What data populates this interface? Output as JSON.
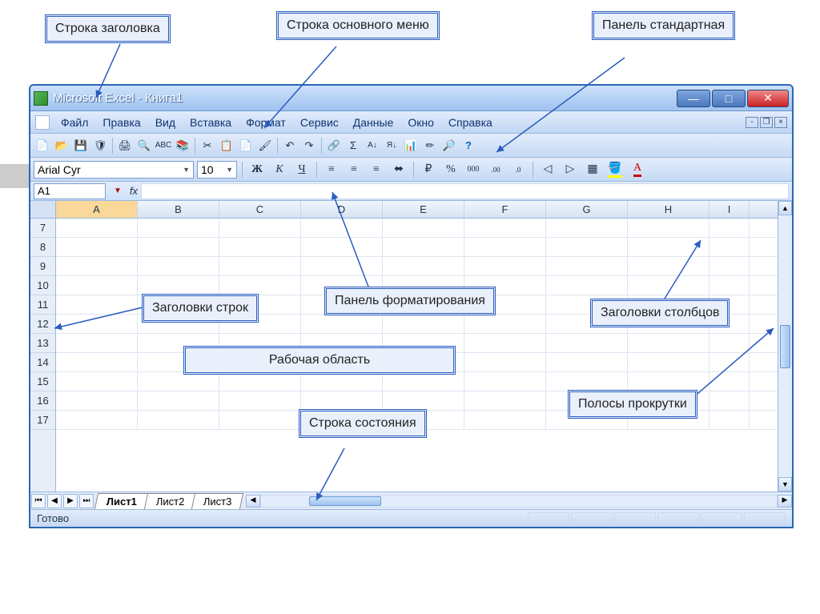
{
  "callouts": {
    "title_bar": "Строка заголовка",
    "main_menu": "Строка основного меню",
    "std_toolbar": "Панель стандартная",
    "row_headers": "Заголовки строк",
    "format_toolbar": "Панель форматирования",
    "col_headers": "Заголовки столбцов",
    "workspace": "Рабочая область",
    "status_bar": "Строка состояния",
    "scrollbars": "Полосы прокрутки"
  },
  "window": {
    "title": "Microsoft Excel - Книга1"
  },
  "menu": {
    "items": [
      "Файл",
      "Правка",
      "Вид",
      "Вставка",
      "Формат",
      "Сервис",
      "Данные",
      "Окно",
      "Справка"
    ]
  },
  "standard_toolbar": {
    "icons": [
      "new",
      "open",
      "save",
      "permission",
      "print",
      "preview",
      "spelling",
      "research",
      "cut",
      "copy",
      "paste",
      "format-painter",
      "undo",
      "redo",
      "hyperlink",
      "autosum",
      "sort-asc",
      "sort-desc",
      "chart",
      "drawing",
      "zoom",
      "help"
    ]
  },
  "format_toolbar": {
    "font": "Arial Cyr",
    "size": "10",
    "bold": "Ж",
    "italic": "К",
    "underline": "Ч",
    "buttons": [
      "align-left",
      "align-center",
      "align-right",
      "merge",
      "currency",
      "percent",
      "comma",
      "inc-dec",
      "dec-dec",
      "indent-dec",
      "indent-inc",
      "borders",
      "fill",
      "font-color"
    ]
  },
  "formula_bar": {
    "name_box": "A1",
    "fx": "fx"
  },
  "grid": {
    "columns": [
      "A",
      "B",
      "C",
      "D",
      "E",
      "F",
      "G",
      "H",
      "I"
    ],
    "rows": [
      "7",
      "8",
      "9",
      "10",
      "11",
      "12",
      "13",
      "14",
      "15",
      "16",
      "17"
    ],
    "selected_col": "A"
  },
  "sheets": {
    "tabs": [
      "Лист1",
      "Лист2",
      "Лист3"
    ],
    "active": 0
  },
  "status": {
    "ready": "Готово"
  }
}
